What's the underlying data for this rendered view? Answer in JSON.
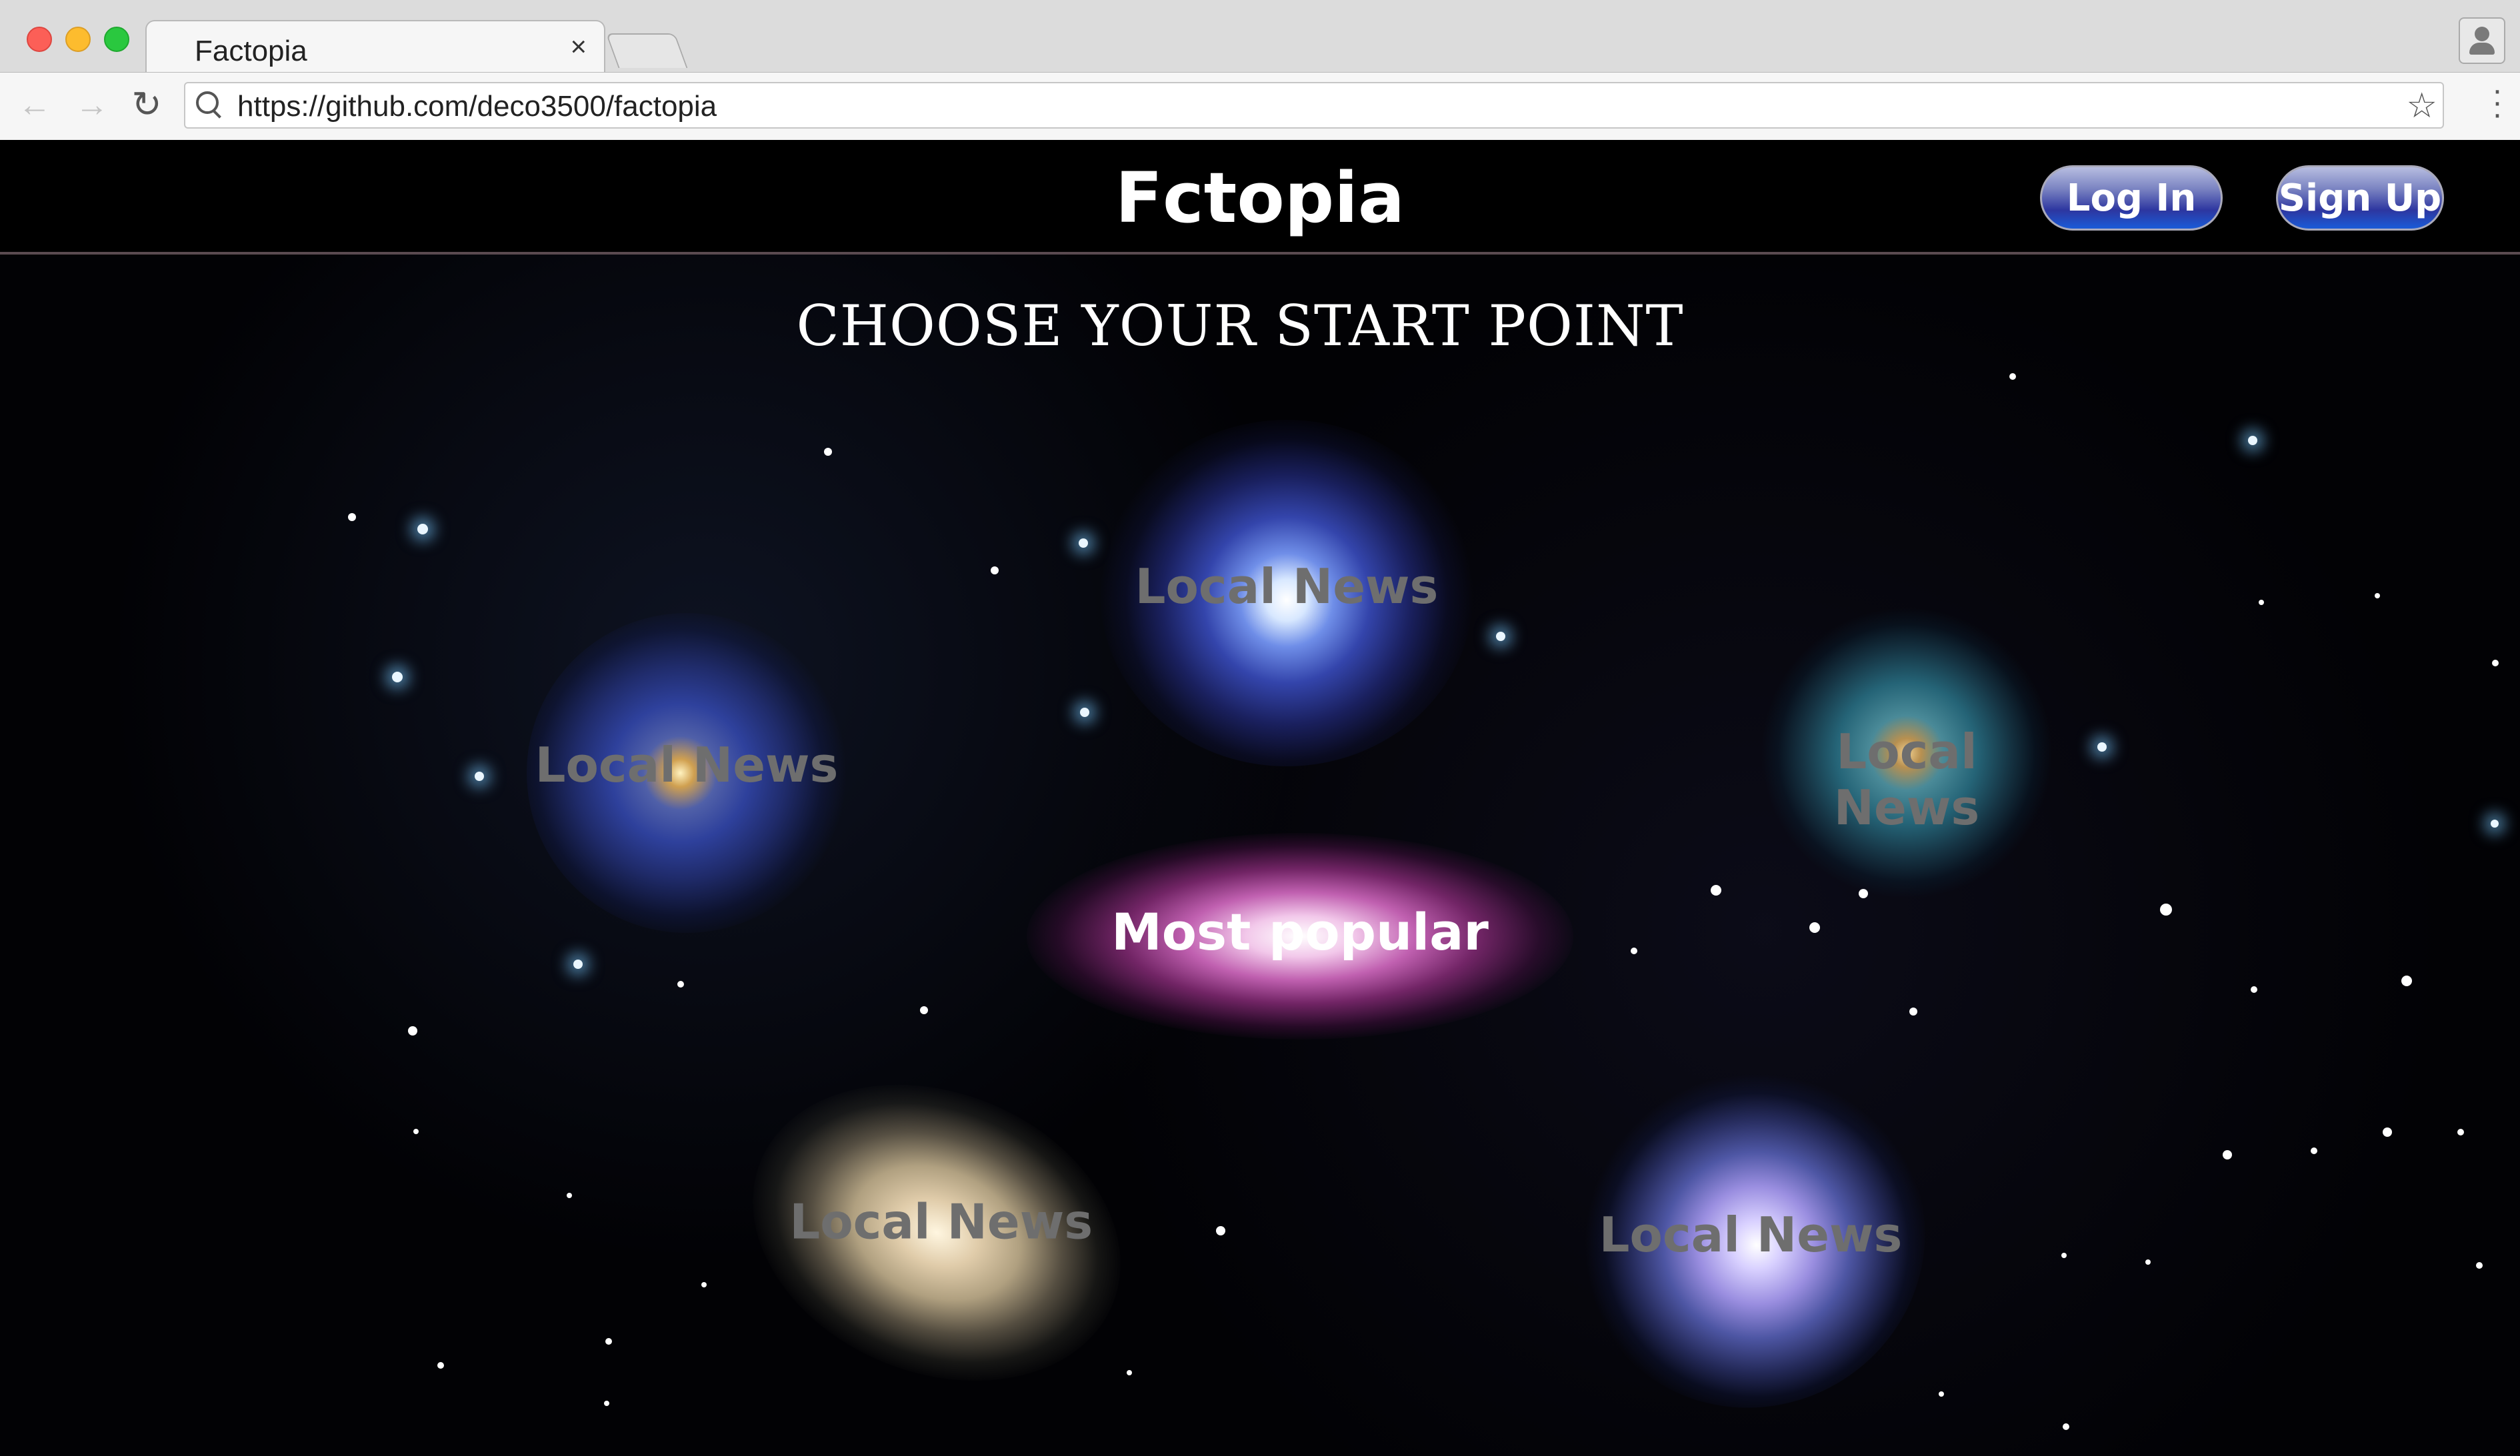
{
  "browser": {
    "tab_title": "Factopia",
    "tab_close_icon": "close-icon",
    "url": "https://github.com/deco3500/factopia"
  },
  "site": {
    "title": "Fctopia",
    "login_label": "Log In",
    "signup_label": "Sign Up",
    "heading": "CHOOSE YOUR START POINT"
  },
  "galaxies": [
    {
      "label": "Local News"
    },
    {
      "label": "Local News"
    },
    {
      "label": "Local News"
    },
    {
      "label": "Most popular"
    },
    {
      "label": "Local News"
    },
    {
      "label": "Local News"
    }
  ],
  "colors": {
    "page_background": "#000000",
    "button_gradient_bottom": "#1a5bd8",
    "galaxy_label": "#6e6e6e"
  }
}
